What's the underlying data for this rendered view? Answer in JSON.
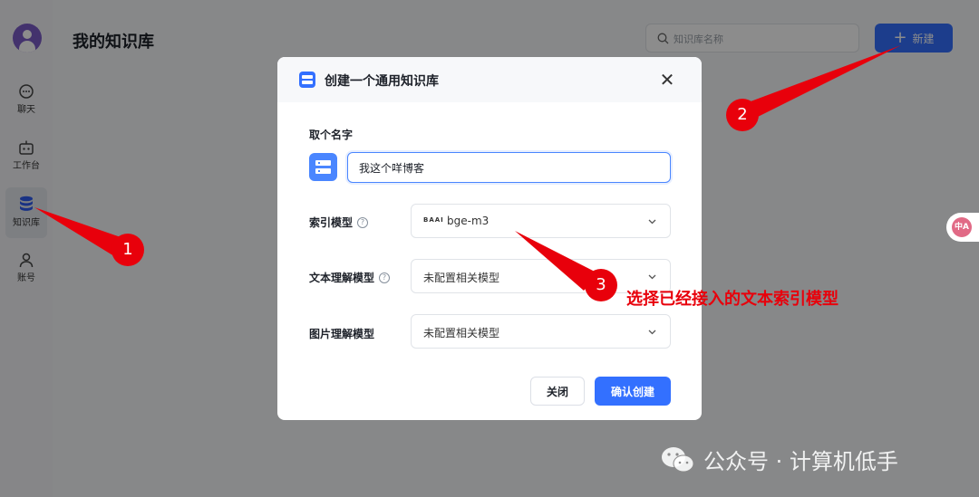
{
  "sidebar": {
    "items": [
      {
        "label": "聊天",
        "icon": "chat-icon"
      },
      {
        "label": "工作台",
        "icon": "robot-icon"
      },
      {
        "label": "知识库",
        "icon": "database-icon",
        "active": true
      },
      {
        "label": "账号",
        "icon": "user-icon"
      }
    ]
  },
  "header": {
    "title": "我的知识库",
    "search_placeholder": "知识库名称",
    "new_label": "新建"
  },
  "modal": {
    "title": "创建一个通用知识库",
    "name_label": "取个名字",
    "name_value": "我这个咩博客",
    "index_model_label": "索引模型",
    "index_model_brand": "BAAI",
    "index_model_value": "bge-m3",
    "text_model_label": "文本理解模型",
    "text_model_value": "未配置相关模型",
    "image_model_label": "图片理解模型",
    "image_model_value": "未配置相关模型",
    "close_label": "关闭",
    "confirm_label": "确认创建"
  },
  "annotations": {
    "step1": "1",
    "step2": "2",
    "step3": "3",
    "step3_text": "选择已经接入的文本索引模型",
    "color": "#e8000b"
  },
  "translate_icon_text": "中A",
  "watermark": "公众号 · 计算机低手",
  "colors": {
    "primary": "#3370ff",
    "avatar": "#7b5bc7"
  }
}
